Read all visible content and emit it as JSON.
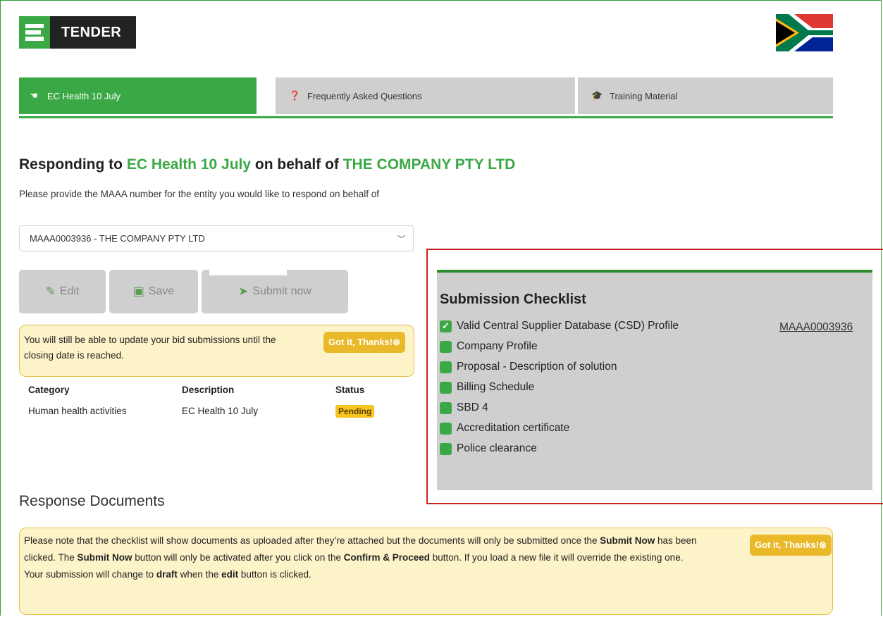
{
  "brand": {
    "logo_text": "TENDER"
  },
  "tabs": [
    {
      "label": "EC Health 10 July",
      "icon": "hand-pointer-icon",
      "active": true
    },
    {
      "label": "Frequently Asked Questions",
      "icon": "question-circle-icon",
      "active": false
    },
    {
      "label": "Training Material",
      "icon": "graduation-cap-icon",
      "active": false
    }
  ],
  "heading": {
    "prefix": "Responding to ",
    "tender": "EC Health 10 July",
    "middle": " on behalf of ",
    "company": "THE COMPANY PTY LTD"
  },
  "intro": "Please provide the MAAA number for the entity you would like to respond on behalf of",
  "entity_select": {
    "value": "MAAA0003936 - THE COMPANY PTY LTD"
  },
  "actions": {
    "edit": "Edit",
    "save": "Save",
    "submit": "Submit now"
  },
  "notice1": {
    "text": "You will still be able to update your bid submissions until the closing date is reached.",
    "dismiss": "Got it, Thanks!⊗"
  },
  "category_table": {
    "headers": [
      "Category",
      "Description",
      "Status"
    ],
    "rows": [
      {
        "category": "Human health activities",
        "description": "EC Health 10 July",
        "status": "Pending"
      }
    ]
  },
  "checklist": {
    "title": "Submission Checklist",
    "items": [
      {
        "label": "Valid Central Supplier Database (CSD) Profile",
        "checked": true,
        "link": "MAAA0003936"
      },
      {
        "label": "Company Profile",
        "checked": false
      },
      {
        "label": "Proposal - Description of solution",
        "checked": false
      },
      {
        "label": "Billing Schedule",
        "checked": false
      },
      {
        "label": "SBD 4",
        "checked": false
      },
      {
        "label": "Accreditation certificate",
        "checked": false
      },
      {
        "label": "Police clearance",
        "checked": false
      }
    ]
  },
  "response_docs": {
    "title": "Response Documents",
    "notice": {
      "p1_a": "Please note that the checklist will show documents as uploaded after they’re attached but the documents will only be submitted once the ",
      "p1_b": "Submit Now",
      "p1_c": " has been clicked. The ",
      "p1_d": "Submit Now",
      "p1_e": " button will only be activated after you click on the ",
      "p1_f": "Confirm & Proceed",
      "p1_g": " button. If you load a new file it will override the existing one.",
      "p2_a": "Your submission will change to ",
      "p2_b": "draft",
      "p2_c": " when the ",
      "p2_d": "edit",
      "p2_e": " button is clicked.",
      "dismiss": "Got it, Thanks!⊗"
    }
  },
  "colors": {
    "brand_green": "#3aa845",
    "tab_grey": "#cfcfcf",
    "notice_bg": "#fdf3c9",
    "highlight_red": "#cc1f1f",
    "badge_yellow": "#f6c420"
  }
}
